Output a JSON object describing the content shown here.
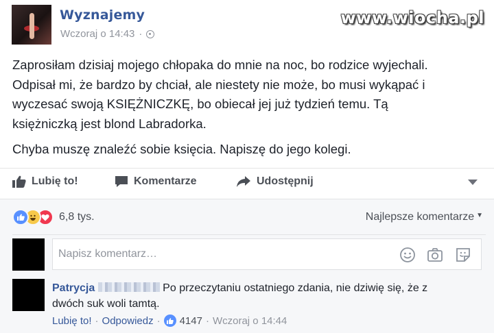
{
  "post": {
    "page_name": "Wyznajemy",
    "time": "Wczoraj o 14:43",
    "time_separator": "·",
    "paragraph1_line1": "Zaprosiłam dzisiaj mojego chłopaka do mnie na noc, bo rodzice wyjechali.",
    "paragraph1_line2": "Odpisał mi, że bardzo by chciał, ale niestety nie może, bo musi wykąpać i",
    "paragraph1_line3": "wyczesać swoją KSIĘŻNICZKĘ, bo obiecał jej już tydzień temu. Tą",
    "paragraph1_line4": "księżniczką jest blond Labradorka.",
    "paragraph2": "Chyba muszę znaleźć sobie księcia. Napiszę do jego kolegi."
  },
  "watermark": "www.wiocha.pl",
  "actions": {
    "like": "Lubię to!",
    "comment": "Komentarze",
    "share": "Udostępnij"
  },
  "reactions": {
    "count": "6,8 tys.",
    "sort_label": "Najlepsze komentarze",
    "icons": [
      "like-icon",
      "haha-icon",
      "love-icon"
    ],
    "colors": {
      "like": "#5890ff",
      "haha": "#f7c94a",
      "love": "#f0384f"
    }
  },
  "comment_input": {
    "placeholder": "Napisz komentarz…"
  },
  "comment": {
    "author": "Patrycja",
    "text_line1": "Po przeczytaniu ostatniego zdania, nie dziwię się, że z",
    "text_line2": "dwóch suk woli tamtą.",
    "like_link": "Lubię to!",
    "reply_link": "Odpowiedz",
    "likes": "4147",
    "time": "Wczoraj o 14:44",
    "separator": "·"
  },
  "colors": {
    "link_blue": "#365899",
    "meta_gray": "#90949c",
    "background_gray": "#f6f7f9"
  }
}
